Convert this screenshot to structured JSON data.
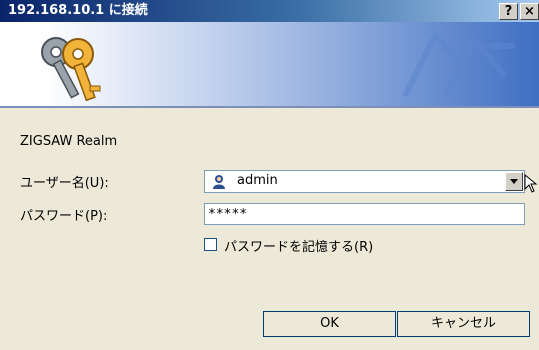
{
  "window": {
    "title": "192.168.10.1 に接続",
    "help_button": "?",
    "close_button": "×"
  },
  "realm": "ZIGSAW Realm",
  "fields": {
    "username_label": "ユーザー名(U):",
    "username_value": "admin",
    "password_label": "パスワード(P):",
    "password_value": "*****"
  },
  "remember": {
    "label": "パスワードを記憶する(R)",
    "checked": false
  },
  "buttons": {
    "ok": "OK",
    "cancel": "キャンセル"
  },
  "colors": {
    "titlebar": "#0a246a",
    "banner_accent": "#3f6fc2",
    "dialog_bg": "#ece9d8"
  }
}
